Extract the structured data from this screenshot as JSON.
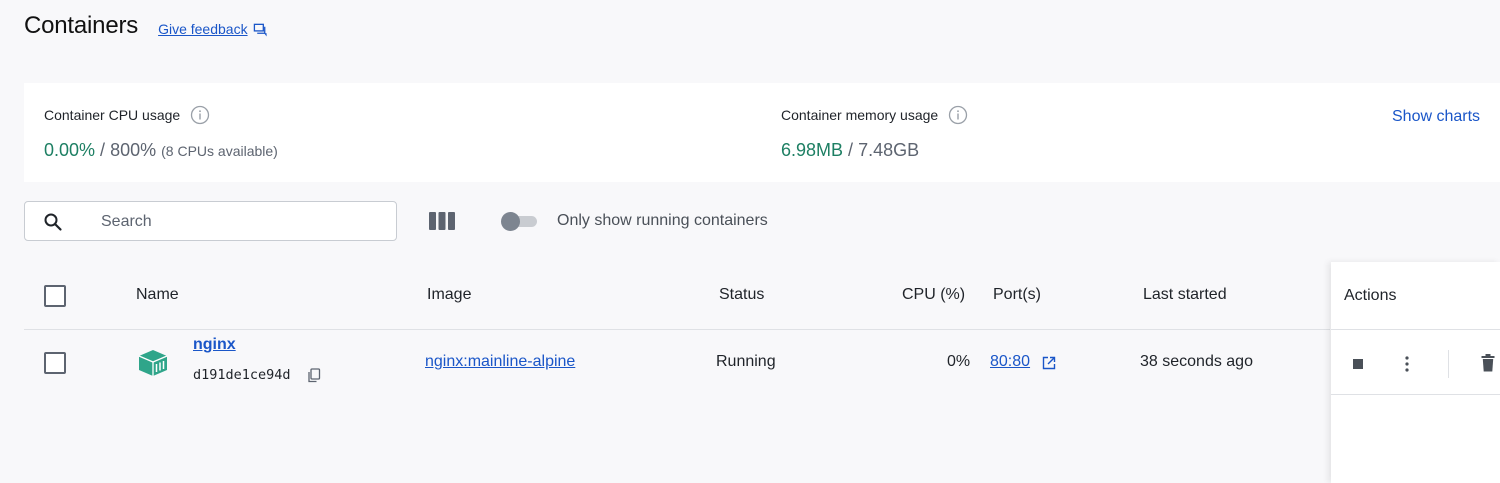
{
  "header": {
    "title": "Containers",
    "feedback_label": "Give feedback"
  },
  "stats": {
    "cpu": {
      "label": "Container CPU usage",
      "value": "0.00%",
      "separator": " / ",
      "total": "800%",
      "note": "(8 CPUs available)"
    },
    "memory": {
      "label": "Container memory usage",
      "value": "6.98MB",
      "separator": " / ",
      "total": "7.48GB"
    },
    "show_charts_label": "Show charts"
  },
  "toolbar": {
    "search_placeholder": "Search",
    "running_toggle_label": "Only show running containers",
    "running_toggle_on": false
  },
  "table": {
    "columns": {
      "name": "Name",
      "image": "Image",
      "status": "Status",
      "cpu": "CPU (%)",
      "ports": "Port(s)",
      "last_started": "Last started",
      "actions": "Actions"
    },
    "rows": [
      {
        "name": "nginx",
        "id": "d191de1ce94d",
        "image": "nginx:mainline-alpine",
        "status": "Running",
        "cpu": "0%",
        "ports": "80:80",
        "last_started": "38 seconds ago"
      }
    ]
  },
  "colors": {
    "accent_link": "#1a56c8",
    "usage_green": "#1d7f63",
    "container_icon": "#2fa58a"
  },
  "icons": {
    "feedback": "feedback-icon",
    "info": "info-icon",
    "search": "search-icon",
    "columns": "columns-icon",
    "container": "container-icon",
    "copy": "copy-icon",
    "external_link": "external-link-icon",
    "stop": "stop-icon",
    "more": "more-vertical-icon",
    "delete": "trash-icon"
  }
}
